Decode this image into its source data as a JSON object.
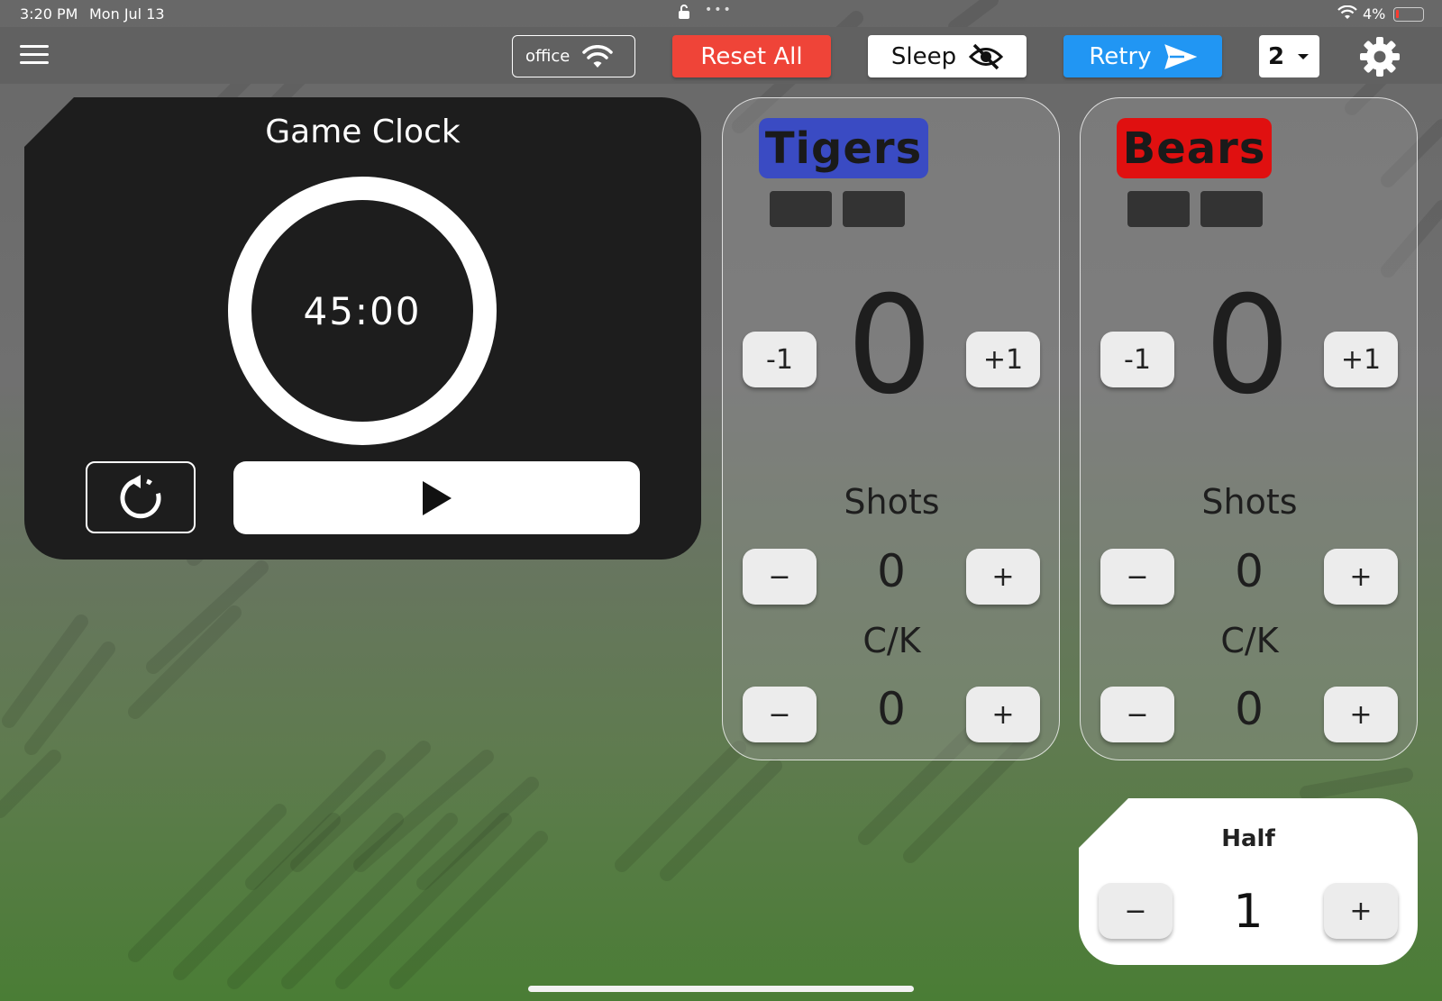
{
  "status_bar": {
    "time": "3:20 PM",
    "date": "Mon Jul 13",
    "dots": "•••",
    "battery": "4%"
  },
  "toolbar": {
    "network": "office",
    "reset_all": "Reset All",
    "sleep": "Sleep",
    "retry": "Retry",
    "count_selected": "2"
  },
  "game_clock": {
    "title": "Game Clock",
    "time": "45:00"
  },
  "teams": [
    {
      "name": "Tigers",
      "color": "#3a4bc3",
      "score": "0",
      "shots_label": "Shots",
      "shots": "0",
      "ck_label": "C/K",
      "ck": "0",
      "minus_one": "-1",
      "plus_one": "+1",
      "minus": "−",
      "plus": "+"
    },
    {
      "name": "Bears",
      "color": "#e01010",
      "score": "0",
      "shots_label": "Shots",
      "shots": "0",
      "ck_label": "C/K",
      "ck": "0",
      "minus_one": "-1",
      "plus_one": "+1",
      "minus": "−",
      "plus": "+"
    }
  ],
  "half": {
    "label": "Half",
    "value": "1",
    "minus": "−",
    "plus": "+"
  },
  "colors": {
    "reset": "#ef4438",
    "retry": "#2196f3",
    "clock_bg": "#1d1d1d"
  }
}
